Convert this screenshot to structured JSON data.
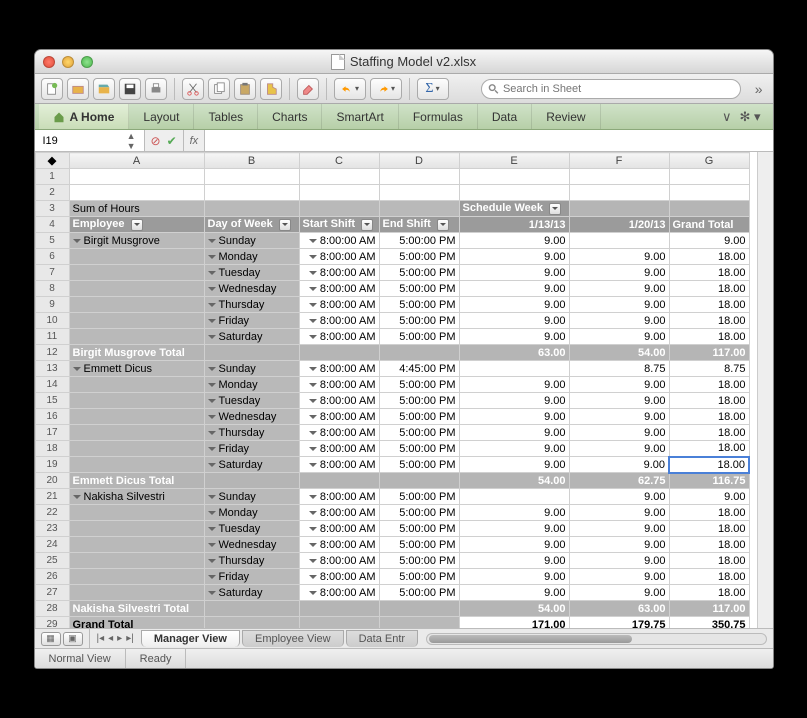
{
  "window_title": "Staffing Model v2.xlsx",
  "search": {
    "placeholder": "Search in Sheet"
  },
  "ribbon": {
    "tabs": [
      "A Home",
      "Layout",
      "Tables",
      "Charts",
      "SmartArt",
      "Formulas",
      "Data",
      "Review"
    ]
  },
  "name_box": "I19",
  "fx_label": "fx",
  "columns": [
    "A",
    "B",
    "C",
    "D",
    "E",
    "F",
    "G"
  ],
  "pivot": {
    "title": "Sum of Hours",
    "schedule_week_label": "Schedule Week",
    "headers": {
      "employee": "Employee",
      "day_of_week": "Day of Week",
      "start_shift": "Start Shift",
      "end_shift": "End Shift",
      "date1": "1/13/13",
      "date2": "1/20/13",
      "grand_total": "Grand Total"
    },
    "groups": [
      {
        "name": "Birgit Musgrove",
        "rows": [
          {
            "day": "Sunday",
            "start": "8:00:00 AM",
            "end": "5:00:00 PM",
            "v1": "9.00",
            "v2": "",
            "gt": "9.00"
          },
          {
            "day": "Monday",
            "start": "8:00:00 AM",
            "end": "5:00:00 PM",
            "v1": "9.00",
            "v2": "9.00",
            "gt": "18.00"
          },
          {
            "day": "Tuesday",
            "start": "8:00:00 AM",
            "end": "5:00:00 PM",
            "v1": "9.00",
            "v2": "9.00",
            "gt": "18.00"
          },
          {
            "day": "Wednesday",
            "start": "8:00:00 AM",
            "end": "5:00:00 PM",
            "v1": "9.00",
            "v2": "9.00",
            "gt": "18.00"
          },
          {
            "day": "Thursday",
            "start": "8:00:00 AM",
            "end": "5:00:00 PM",
            "v1": "9.00",
            "v2": "9.00",
            "gt": "18.00"
          },
          {
            "day": "Friday",
            "start": "8:00:00 AM",
            "end": "5:00:00 PM",
            "v1": "9.00",
            "v2": "9.00",
            "gt": "18.00"
          },
          {
            "day": "Saturday",
            "start": "8:00:00 AM",
            "end": "5:00:00 PM",
            "v1": "9.00",
            "v2": "9.00",
            "gt": "18.00"
          }
        ],
        "total_label": "Birgit Musgrove Total",
        "total": {
          "v1": "63.00",
          "v2": "54.00",
          "gt": "117.00"
        }
      },
      {
        "name": "Emmett Dicus",
        "rows": [
          {
            "day": "Sunday",
            "start": "8:00:00 AM",
            "end": "4:45:00 PM",
            "v1": "",
            "v2": "8.75",
            "gt": "8.75"
          },
          {
            "day": "Monday",
            "start": "8:00:00 AM",
            "end": "5:00:00 PM",
            "v1": "9.00",
            "v2": "9.00",
            "gt": "18.00"
          },
          {
            "day": "Tuesday",
            "start": "8:00:00 AM",
            "end": "5:00:00 PM",
            "v1": "9.00",
            "v2": "9.00",
            "gt": "18.00"
          },
          {
            "day": "Wednesday",
            "start": "8:00:00 AM",
            "end": "5:00:00 PM",
            "v1": "9.00",
            "v2": "9.00",
            "gt": "18.00"
          },
          {
            "day": "Thursday",
            "start": "8:00:00 AM",
            "end": "5:00:00 PM",
            "v1": "9.00",
            "v2": "9.00",
            "gt": "18.00"
          },
          {
            "day": "Friday",
            "start": "8:00:00 AM",
            "end": "5:00:00 PM",
            "v1": "9.00",
            "v2": "9.00",
            "gt": "18.00"
          },
          {
            "day": "Saturday",
            "start": "8:00:00 AM",
            "end": "5:00:00 PM",
            "v1": "9.00",
            "v2": "9.00",
            "gt": "18.00"
          }
        ],
        "total_label": "Emmett Dicus Total",
        "total": {
          "v1": "54.00",
          "v2": "62.75",
          "gt": "116.75"
        }
      },
      {
        "name": "Nakisha Silvestri",
        "rows": [
          {
            "day": "Sunday",
            "start": "8:00:00 AM",
            "end": "5:00:00 PM",
            "v1": "",
            "v2": "9.00",
            "gt": "9.00"
          },
          {
            "day": "Monday",
            "start": "8:00:00 AM",
            "end": "5:00:00 PM",
            "v1": "9.00",
            "v2": "9.00",
            "gt": "18.00"
          },
          {
            "day": "Tuesday",
            "start": "8:00:00 AM",
            "end": "5:00:00 PM",
            "v1": "9.00",
            "v2": "9.00",
            "gt": "18.00"
          },
          {
            "day": "Wednesday",
            "start": "8:00:00 AM",
            "end": "5:00:00 PM",
            "v1": "9.00",
            "v2": "9.00",
            "gt": "18.00"
          },
          {
            "day": "Thursday",
            "start": "8:00:00 AM",
            "end": "5:00:00 PM",
            "v1": "9.00",
            "v2": "9.00",
            "gt": "18.00"
          },
          {
            "day": "Friday",
            "start": "8:00:00 AM",
            "end": "5:00:00 PM",
            "v1": "9.00",
            "v2": "9.00",
            "gt": "18.00"
          },
          {
            "day": "Saturday",
            "start": "8:00:00 AM",
            "end": "5:00:00 PM",
            "v1": "9.00",
            "v2": "9.00",
            "gt": "18.00"
          }
        ],
        "total_label": "Nakisha Silvestri Total",
        "total": {
          "v1": "54.00",
          "v2": "63.00",
          "gt": "117.00"
        }
      }
    ],
    "grand_total_label": "Grand Total",
    "grand_total": {
      "v1": "171.00",
      "v2": "179.75",
      "gt": "350.75"
    }
  },
  "sheet_tabs": [
    "Manager View",
    "Employee View",
    "Data Entr"
  ],
  "status": {
    "view": "Normal View",
    "ready": "Ready"
  },
  "selected_cell_row": 19,
  "toolbar_icons": [
    "new",
    "open",
    "prev",
    "save",
    "print",
    "cut",
    "copy",
    "paste",
    "format",
    "paint",
    "undo",
    "redo",
    "sum"
  ]
}
